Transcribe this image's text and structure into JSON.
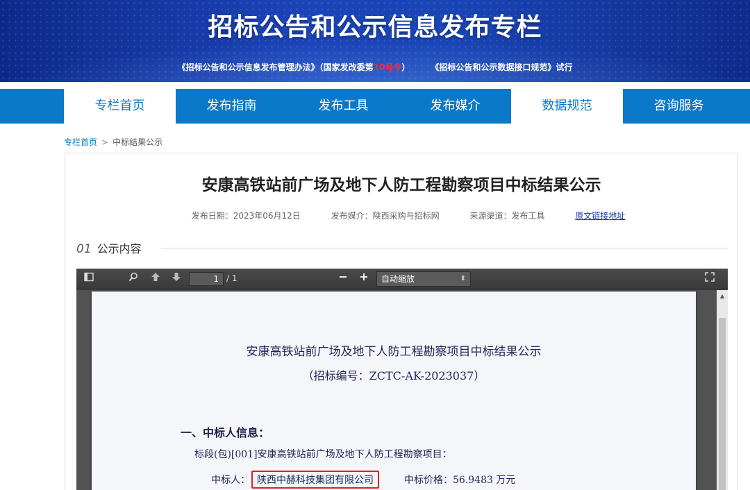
{
  "banner": {
    "title": "招标公告和公示信息发布专栏",
    "sub_part1": "《招标公告和公示信息发布管理办法》（国家发改委第",
    "sub_highlight": "10号令",
    "sub_part2": "）",
    "sub_part3": "《招标公告和公示数据接口规范》试行"
  },
  "nav": {
    "items": [
      {
        "label": "专栏首页"
      },
      {
        "label": "发布指南"
      },
      {
        "label": "发布工具"
      },
      {
        "label": "发布媒介"
      },
      {
        "label": "数据规范"
      },
      {
        "label": "咨询服务"
      }
    ]
  },
  "breadcrumb": {
    "home": "专栏首页",
    "separator": ">",
    "current": "中标结果公示"
  },
  "article": {
    "title": "安康高铁站前广场及地下人防工程勘察项目中标结果公示",
    "date": "发布日期：2023年06月12日",
    "media": "发布媒介：陕西采购与招标网",
    "channel": "来源渠道：发布工具",
    "original_link": "原文链接地址"
  },
  "section": {
    "number": "01",
    "label": "公示内容"
  },
  "pdf_viewer": {
    "page_current": "1",
    "page_total": "/ 1",
    "zoom": "自动缩放",
    "icons": {
      "sidebar": "sidebar-toggle-icon",
      "search": "search-icon",
      "prev": "arrow-up-icon",
      "next": "arrow-down-icon",
      "zoom_out": "minus-icon",
      "zoom_in": "plus-icon",
      "fullscreen": "fullscreen-icon"
    }
  },
  "document": {
    "title": "安康高铁站前广场及地下人防工程勘察项目中标结果公示",
    "bid_number": "（招标编号：ZCTC-AK-2023037）",
    "heading": "一、中标人信息：",
    "lot": "标段(包)[001]安康高铁站前广场及地下人防工程勘察项目：",
    "winner_label": "中标人：",
    "winner_name": "陕西中赫科技集团有限公司",
    "price": "中标价格：56.9483 万元"
  },
  "colors": {
    "banner_blue": "#1b44b8",
    "nav_blue": "#0a79c9",
    "highlight_red": "#e02020"
  }
}
